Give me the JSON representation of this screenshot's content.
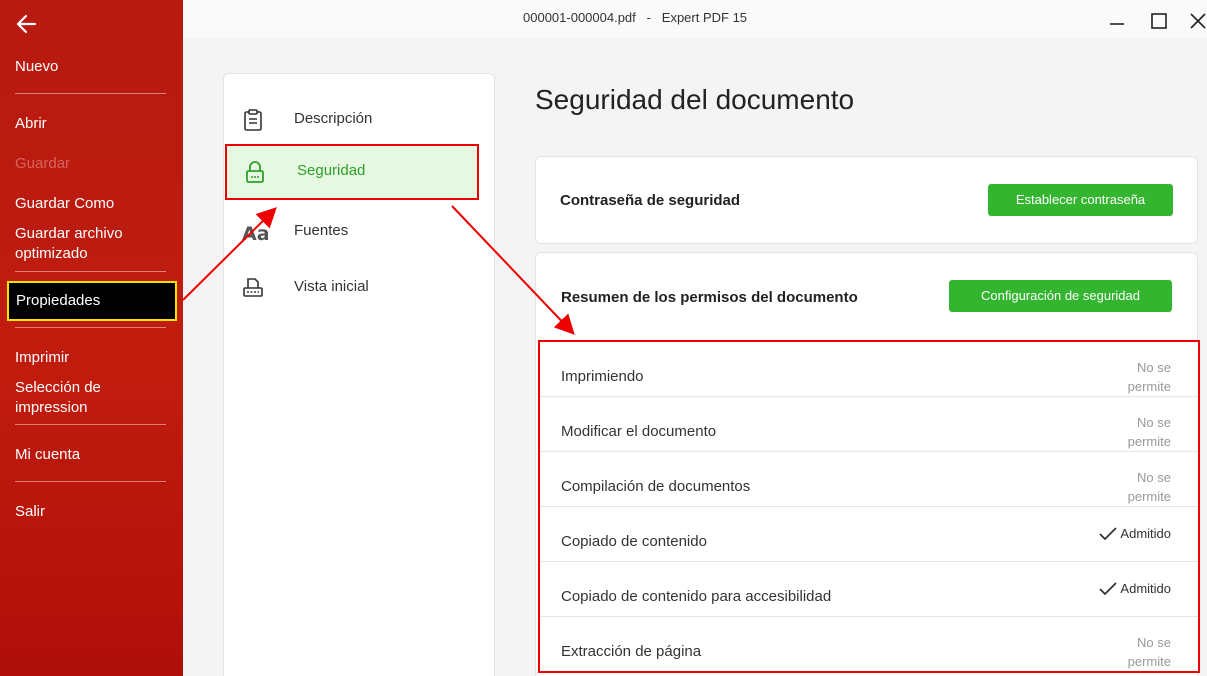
{
  "window": {
    "title": "000001-000004.pdf   -   Expert PDF 15"
  },
  "sidebar": {
    "items": [
      {
        "label": "Nuevo"
      },
      {
        "label": "Abrir"
      },
      {
        "label": "Guardar"
      },
      {
        "label": "Guardar Como"
      },
      {
        "label": "Guardar archivo optimizado"
      },
      {
        "label": "Propiedades"
      },
      {
        "label": "Imprimir"
      },
      {
        "label": "Selección de impression"
      },
      {
        "label": "Mi cuenta"
      },
      {
        "label": "Salir"
      }
    ]
  },
  "panel": {
    "items": [
      {
        "label": "Descripción",
        "icon": "clipboard-icon"
      },
      {
        "label": "Seguridad",
        "icon": "lock-icon"
      },
      {
        "label": "Fuentes",
        "icon": "font-icon"
      },
      {
        "label": "Vista inicial",
        "icon": "printer-page-icon"
      }
    ]
  },
  "main": {
    "title": "Seguridad del documento",
    "password_card": {
      "label": "Contraseña de seguridad",
      "button": "Establecer contraseña"
    },
    "permissions_card": {
      "label": "Resumen de los permisos del documento",
      "button": "Configuración de seguridad"
    },
    "permissions": [
      {
        "name": "Imprimiendo",
        "status": "No se permite",
        "allowed": false
      },
      {
        "name": "Modificar el documento",
        "status": "No se permite",
        "allowed": false
      },
      {
        "name": "Compilación de documentos",
        "status": "No se permite",
        "allowed": false
      },
      {
        "name": "Copiado de contenido",
        "status": "Admitido",
        "allowed": true
      },
      {
        "name": "Copiado de contenido para accesibilidad",
        "status": "Admitido",
        "allowed": true
      },
      {
        "name": "Extracción de página",
        "status": "No se permite",
        "allowed": false
      }
    ]
  },
  "colors": {
    "sidebar": "#b71a10",
    "accent_green": "#34b530",
    "highlight_red": "#ee0000",
    "highlight_yellow": "#f2e600"
  }
}
